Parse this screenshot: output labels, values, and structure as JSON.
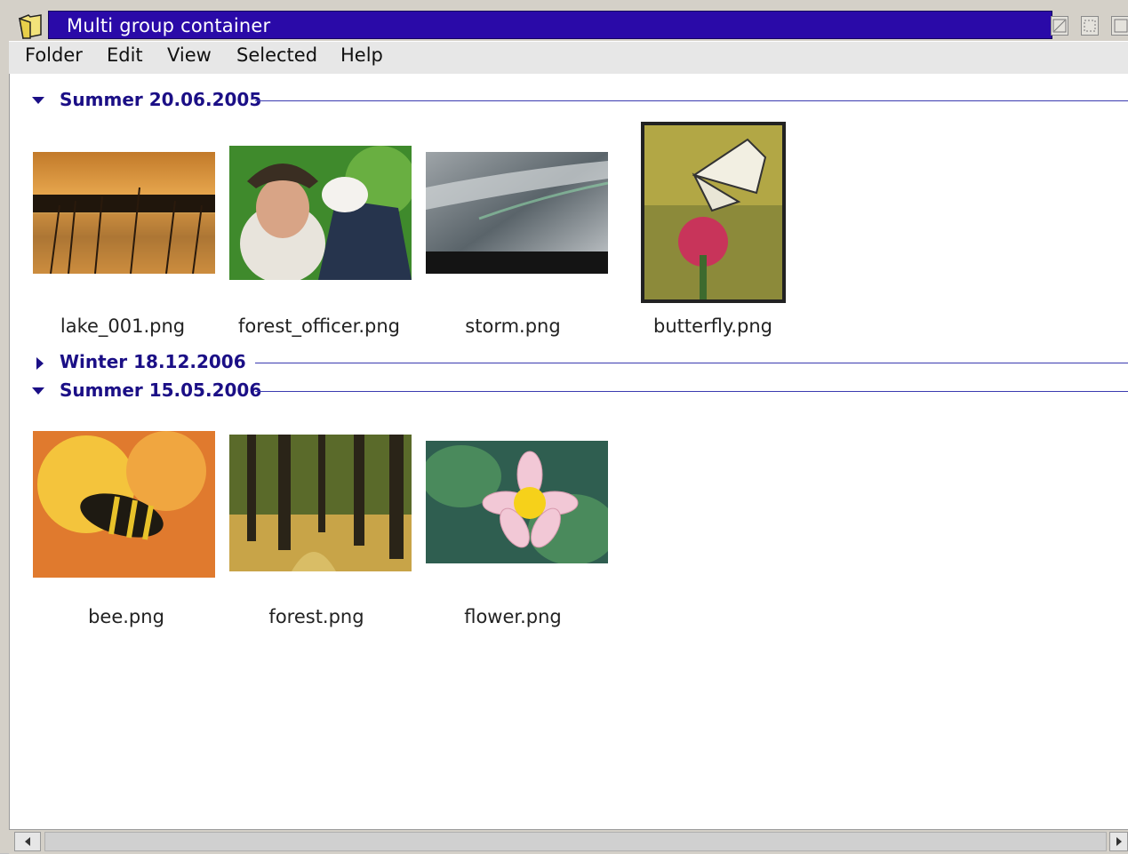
{
  "window": {
    "title": "Multi group container"
  },
  "menu": {
    "folder": "Folder",
    "edit": "Edit",
    "view": "View",
    "selected": "Selected",
    "help": "Help"
  },
  "groups": [
    {
      "title": "Summer 20.06.2005",
      "expanded": true,
      "items": [
        {
          "label": "lake_001.png",
          "selected": false
        },
        {
          "label": "forest_officer.png",
          "selected": false
        },
        {
          "label": "storm.png",
          "selected": false
        },
        {
          "label": "butterfly.png",
          "selected": true
        }
      ]
    },
    {
      "title": "Winter 18.12.2006",
      "expanded": false,
      "items": []
    },
    {
      "title": "Summer 15.05.2006",
      "expanded": true,
      "items": [
        {
          "label": "bee.png",
          "selected": false
        },
        {
          "label": "forest.png",
          "selected": false
        },
        {
          "label": "flower.png",
          "selected": false
        }
      ]
    }
  ],
  "colors": {
    "titlebar": "#2a0aa8",
    "group_title": "#1b0f86",
    "group_line": "#3b3bb0"
  }
}
